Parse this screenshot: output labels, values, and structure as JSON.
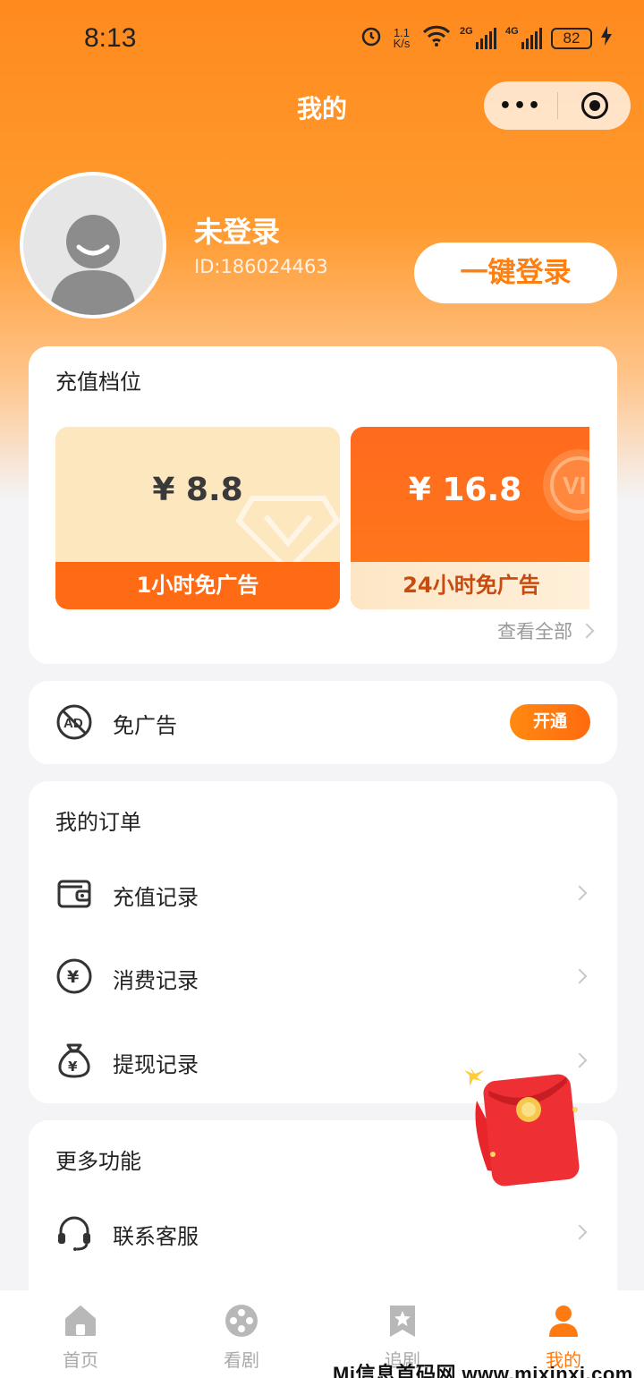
{
  "status_bar": {
    "time": "8:13",
    "net_speed_value": "1.1",
    "net_speed_unit": "K/s",
    "signal1": "2G",
    "signal2": "4G",
    "battery": "82"
  },
  "nav": {
    "title": "我的",
    "more_label": "•••"
  },
  "profile": {
    "name": "未登录",
    "id": "ID:186024463",
    "login_button": "一键登录"
  },
  "recharge": {
    "title": "充值档位",
    "tiers": [
      {
        "price": "¥ 8.8",
        "label": "1小时免广告"
      },
      {
        "price": "¥ 16.8",
        "label": "24小时免广告"
      }
    ],
    "view_all": "查看全部"
  },
  "no_ads": {
    "label": "免广告",
    "button": "开通"
  },
  "orders": {
    "title": "我的订单",
    "items": [
      {
        "label": "充值记录",
        "icon": "wallet-icon"
      },
      {
        "label": "消费记录",
        "icon": "yuan-coin-icon"
      },
      {
        "label": "提现记录",
        "icon": "money-bag-icon"
      }
    ]
  },
  "more": {
    "title": "更多功能",
    "items": [
      {
        "label": "联系客服",
        "icon": "headset-icon"
      }
    ]
  },
  "tabbar": [
    {
      "label": "首页",
      "icon": "home-icon",
      "active": false
    },
    {
      "label": "看剧",
      "icon": "film-reel-icon",
      "active": false
    },
    {
      "label": "追剧",
      "icon": "bookmark-star-icon",
      "active": false
    },
    {
      "label": "我的",
      "icon": "user-icon",
      "active": true
    }
  ],
  "watermark": "Mi信息首码网 www.mixinxi.com",
  "colors": {
    "accent": "#ff7a10",
    "tier_orange": "#ff6a14",
    "tier_cream": "#fde7bf"
  }
}
